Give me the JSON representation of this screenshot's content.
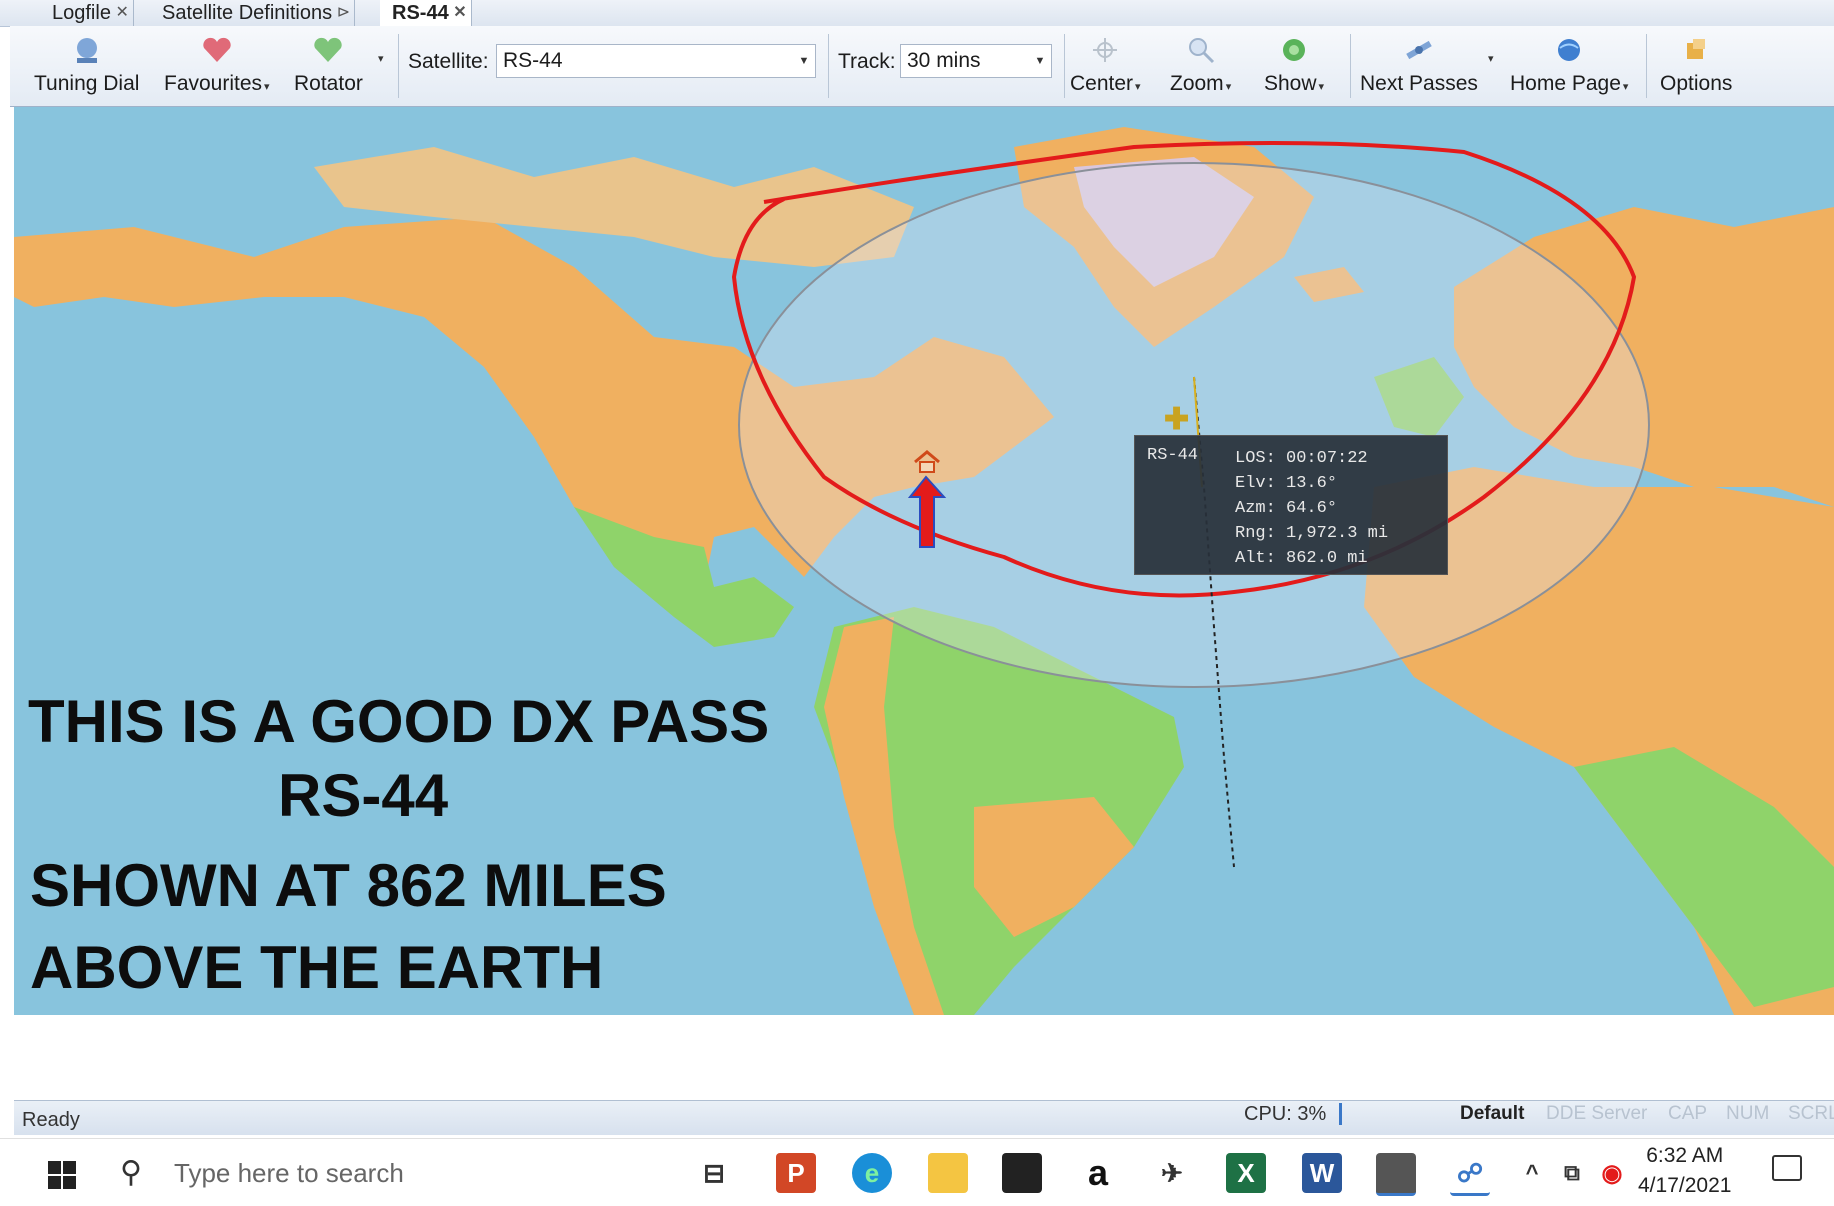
{
  "tabs": [
    {
      "label": "Logfile",
      "active": false
    },
    {
      "label": "Satellite Definitions",
      "active": false
    },
    {
      "label": "RS-44",
      "active": true
    }
  ],
  "toolbar": {
    "tuning_dial": "Tuning Dial",
    "favourites": "Favourites",
    "rotator": "Rotator",
    "satellite_label": "Satellite:",
    "satellite_value": "RS-44",
    "track_label": "Track:",
    "track_value": "30 mins",
    "center": "Center",
    "zoom": "Zoom",
    "show": "Show",
    "next_passes": "Next Passes",
    "home_page": "Home Page",
    "options": "Options"
  },
  "map": {
    "info": {
      "satellite": "RS-44",
      "los": "LOS: 00:07:22",
      "elv": "Elv: 13.6°",
      "azm": "Azm: 64.6°",
      "rng": "Rng: 1,972.3 mi",
      "alt": "Alt: 862.0 mi"
    },
    "annotation": {
      "line1": "THIS IS A GOOD DX PASS",
      "line2": "RS-44",
      "line3": "SHOWN AT 862 MILES",
      "line4": "ABOVE THE EARTH"
    },
    "colors": {
      "ocean": "#88c4dd",
      "land": "#f0b060",
      "lowland": "#8fd36a",
      "footprint_annotation": "#e31b1b",
      "arrow": "#e31b1b"
    }
  },
  "status": {
    "ready": "Ready",
    "cpu": "CPU: 3%",
    "default": "Default",
    "dde": "DDE Server",
    "cap": "CAP",
    "num": "NUM",
    "scrl": "SCRL"
  },
  "taskbar": {
    "search_placeholder": "Type here to search",
    "time": "6:32 AM",
    "date": "4/17/2021"
  }
}
